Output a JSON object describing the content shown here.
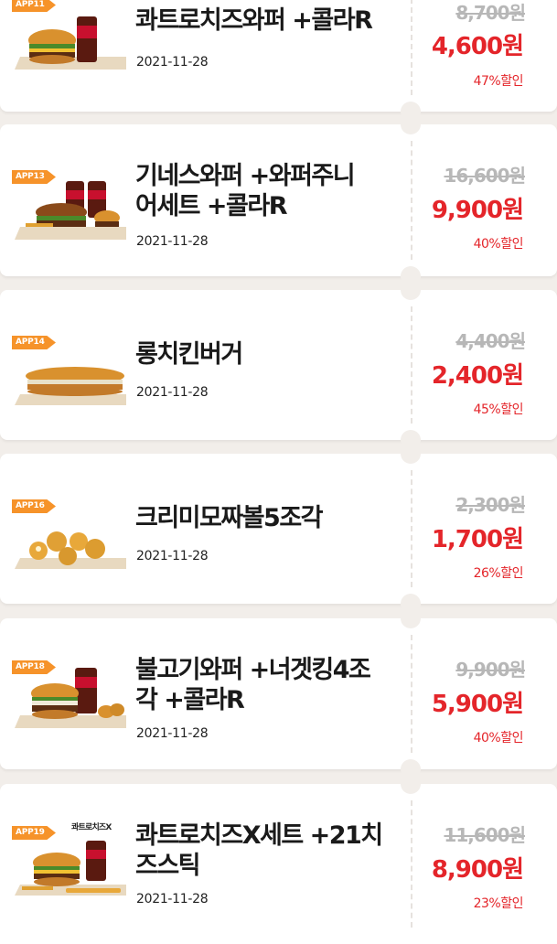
{
  "coupons": [
    {
      "badge": "APP11",
      "title_lines": [
        "콰트로치즈와퍼 +콜라R"
      ],
      "date": "2021-11-28",
      "original_price": "8,700원",
      "sale_price": "4,600원",
      "discount": "47%할인",
      "food": "whopper-cola"
    },
    {
      "badge": "APP13",
      "title_lines": [
        "기네스와퍼 +와퍼주니",
        "어세트 +콜라R"
      ],
      "date": "2021-11-28",
      "original_price": "16,600원",
      "sale_price": "9,900원",
      "discount": "40%할인",
      "food": "two-burgers-drinks"
    },
    {
      "badge": "APP14",
      "title_lines": [
        "롱치킨버거"
      ],
      "date": "2021-11-28",
      "original_price": "4,400원",
      "sale_price": "2,400원",
      "discount": "45%할인",
      "food": "long-burger"
    },
    {
      "badge": "APP16",
      "title_lines": [
        "크리미모짜볼5조각"
      ],
      "date": "2021-11-28",
      "original_price": "2,300원",
      "sale_price": "1,700원",
      "discount": "26%할인",
      "food": "cheese-balls"
    },
    {
      "badge": "APP18",
      "title_lines": [
        "불고기와퍼 +너겟킹4조",
        "각 +콜라R"
      ],
      "date": "2021-11-28",
      "original_price": "9,900원",
      "sale_price": "5,900원",
      "discount": "40%할인",
      "food": "burger-nuggets-cola"
    },
    {
      "badge": "APP19",
      "brand_label": "콰트로치즈X",
      "title_lines": [
        "콰트로치즈X세트 +21치",
        "즈스틱"
      ],
      "date": "2021-11-28",
      "original_price": "11,600원",
      "sale_price": "8,900원",
      "discount": "23%할인",
      "food": "burger-set-sticks"
    }
  ],
  "colors": {
    "background": "#f2eeea",
    "card": "#ffffff",
    "badge": "#f6932a",
    "sale": "#e4252a",
    "original": "#b7b7b7"
  }
}
